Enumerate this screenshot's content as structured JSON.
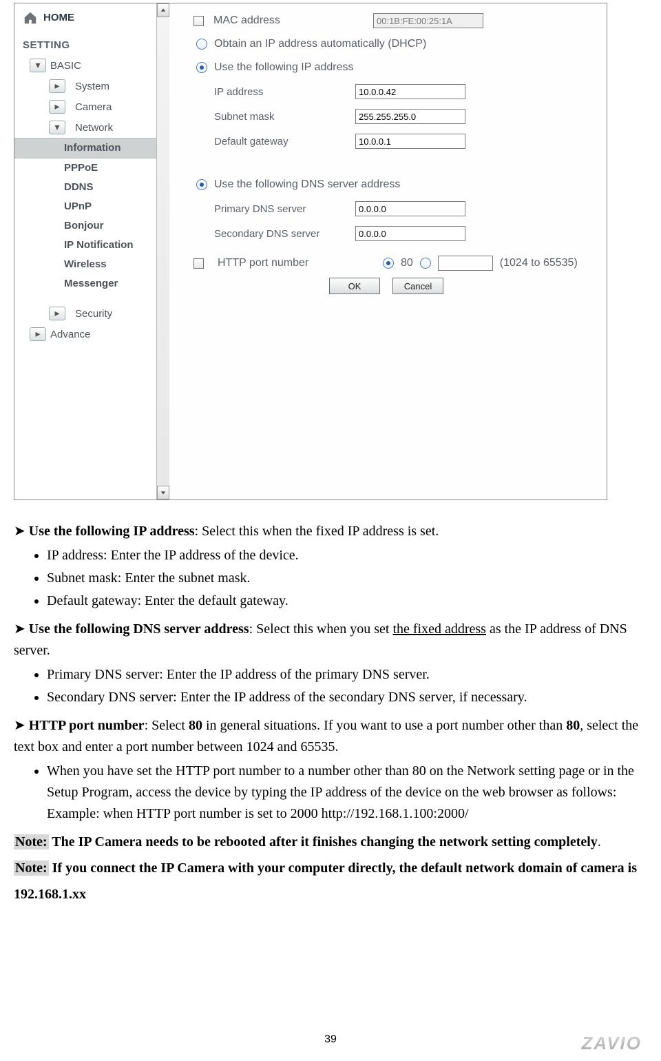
{
  "nav": {
    "home": "HOME",
    "section": "SETTING",
    "basic": "BASIC",
    "items": {
      "system": "System",
      "camera": "Camera",
      "network": "Network",
      "security": "Security"
    },
    "network_children": [
      "Information",
      "PPPoE",
      "DDNS",
      "UPnP",
      "Bonjour",
      "IP Notification",
      "Wireless",
      "Messenger"
    ],
    "advance": "Advance"
  },
  "form": {
    "mac_label": "MAC address",
    "mac": "00:1B:FE:00:25:1A",
    "dhcp": "Obtain an IP address automatically (DHCP)",
    "static": "Use the following IP address",
    "ip_label": "IP address",
    "ip": "10.0.0.42",
    "mask_label": "Subnet mask",
    "mask": "255.255.255.0",
    "gw_label": "Default gateway",
    "gw": "10.0.0.1",
    "dnshdr": "Use the following DNS server address",
    "dns1_label": "Primary DNS server",
    "dns1": "0.0.0.0",
    "dns2_label": "Secondary DNS server",
    "dns2": "0.0.0.0",
    "http_label": "HTTP port number",
    "http80": "80",
    "http_custom": "",
    "http_note": "(1024 to 65535)",
    "ok": "OK",
    "cancel": "Cancel"
  },
  "doc": {
    "p1": {
      "bold": "Use the following IP address",
      "rest": ": Select this when the fixed IP address is set."
    },
    "p1_items": [
      "IP address: Enter the IP address of the device.",
      "Subnet mask: Enter the subnet mask.",
      "Default gateway: Enter the default gateway."
    ],
    "p2": {
      "bold": "Use the following DNS server address",
      "rest1": ": Select this when you set ",
      "u": "the fixed address",
      "rest2": " as the IP address of DNS server."
    },
    "p2_items": [
      "Primary DNS server: Enter the IP address of the primary DNS server.",
      "Secondary DNS server: Enter the IP address of the secondary DNS server, if necessary."
    ],
    "p3": {
      "bold": "HTTP port number",
      "rest1": ": Select ",
      "b2": "80",
      "rest2": " in general situations. If you want to use a port number other than ",
      "b3": "80",
      "rest3": ", select the text box and enter a port number between 1024 and 65535."
    },
    "p3_items": [
      "When you have set the HTTP port number to a number other than 80 on the Network setting page or in the Setup Program, access the device by typing the IP address of the device on the web browser as follows: Example: when HTTP port number is set to 2000 http://192.168.1.100:2000/"
    ],
    "note1a": "Note:",
    "note1b": " The IP Camera needs to be rebooted after it finishes changing the network setting completely",
    "note2a": "Note:",
    "note2b": " If you connect the IP Camera with your computer directly, the default network domain of camera is 192.168.1.xx"
  },
  "page": "39",
  "brand": "ZAVIO"
}
